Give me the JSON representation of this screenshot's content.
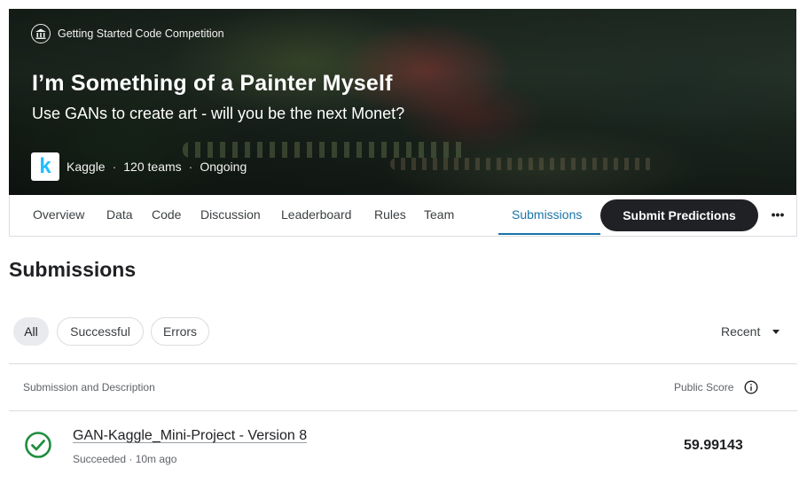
{
  "banner": {
    "competition_type": "Getting Started Code Competition",
    "competition_type_icon": "institution-icon",
    "title": "I’m Something of a Painter Myself",
    "subtitle": "Use GANs to create art - will you be the next Monet?",
    "host_logo_letter": "k",
    "host_name": "Kaggle",
    "separator": "·",
    "teams": "120 teams",
    "status": "Ongoing"
  },
  "tabs": [
    {
      "label": "Overview"
    },
    {
      "label": "Data"
    },
    {
      "label": "Code"
    },
    {
      "label": "Discussion"
    },
    {
      "label": "Leaderboard"
    },
    {
      "label": "Rules"
    },
    {
      "label": "Team"
    },
    {
      "label": "Submissions",
      "active": true
    }
  ],
  "actions": {
    "submit_label": "Submit Predictions",
    "more_icon": "more-horizontal-icon",
    "more_glyph": "•••"
  },
  "page": {
    "heading": "Submissions"
  },
  "filters": {
    "chips": [
      {
        "label": "All",
        "active": true
      },
      {
        "label": "Successful"
      },
      {
        "label": "Errors"
      }
    ],
    "sort_label": "Recent"
  },
  "table": {
    "col_submission": "Submission and Description",
    "col_score": "Public Score",
    "rows": [
      {
        "status_icon": "check-circle-icon",
        "title": "GAN-Kaggle_Mini-Project - Version 8",
        "meta": "Succeeded · 10m ago",
        "score": "59.99143"
      }
    ]
  },
  "colors": {
    "accent": "#1a73a8",
    "success": "#1e8e3e",
    "button_dark": "#202124",
    "kaggle_blue": "#20beff"
  }
}
